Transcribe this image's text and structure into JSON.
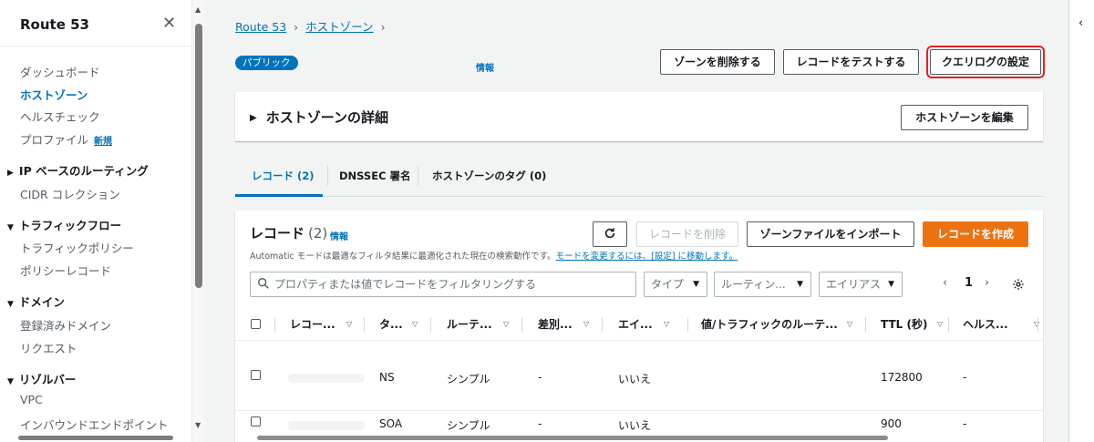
{
  "sidebar": {
    "title": "Route 53",
    "items": {
      "dashboard": "ダッシュボード",
      "hosted_zones": "ホストゾーン",
      "health_checks": "ヘルスチェック",
      "profiles": "プロファイル",
      "profiles_badge": "新規",
      "cidr": "CIDR コレクション",
      "traffic_policies": "トラフィックポリシー",
      "policy_records": "ポリシーレコード",
      "registered_domains": "登録済みドメイン",
      "requests": "リクエスト",
      "vpc": "VPC",
      "inbound_endpoints": "インバウンドエンドポイント"
    },
    "sections": {
      "ip_routing": "IP ベースのルーティング",
      "traffic_flow": "トラフィックフロー",
      "domains": "ドメイン",
      "resolver": "リゾルバー"
    }
  },
  "breadcrumb": {
    "root": "Route 53",
    "hosted_zones": "ホストゾーン"
  },
  "header": {
    "badge": "パブリック",
    "info": "情報",
    "delete_zone": "ゾーンを削除する",
    "test_record": "レコードをテストする",
    "query_logging": "クエリログの設定"
  },
  "details": {
    "title": "ホストゾーンの詳細",
    "edit": "ホストゾーンを編集"
  },
  "tabs": {
    "records": "レコード (2)",
    "dnssec": "DNSSEC 署名",
    "tags": "ホストゾーンのタグ (0)"
  },
  "records": {
    "title": "レコード",
    "count": "(2)",
    "info": "情報",
    "delete": "レコードを削除",
    "import": "ゾーンファイルをインポート",
    "create": "レコードを作成",
    "description": "Automatic モードは最適なフィルタ結果に最適化された現在の検索動作です。",
    "description_link": "モードを変更するには、[設定] に移動します。",
    "search_placeholder": "プロパティまたは値でレコードをフィルタリングする",
    "filter_type": "タイプ",
    "filter_routing": "ルーティン...",
    "filter_alias": "エイリアス",
    "page_prev": "‹",
    "page_num": "1",
    "page_next": "›",
    "columns": {
      "name": "レコー...",
      "type": "タ...",
      "routing": "ルーテ...",
      "differentiator": "差別...",
      "alias": "エイ...",
      "value": "値/トラフィックのルーテ...",
      "ttl": "TTL (秒)",
      "health": "ヘルス..."
    },
    "rows": [
      {
        "type": "NS",
        "routing": "シンプル",
        "differentiator": "-",
        "alias": "いいえ",
        "ttl": "172800",
        "health": "-"
      },
      {
        "type": "SOA",
        "routing": "シンプル",
        "differentiator": "-",
        "alias": "いいえ",
        "ttl": "900",
        "health": "-"
      }
    ]
  },
  "icons": {
    "close": "close-icon",
    "refresh": "refresh-icon",
    "search": "search-icon",
    "settings": "gear-icon"
  },
  "colors": {
    "link": "#0073bb",
    "primary_button": "#ec7211",
    "highlight_outline": "#e02424"
  }
}
